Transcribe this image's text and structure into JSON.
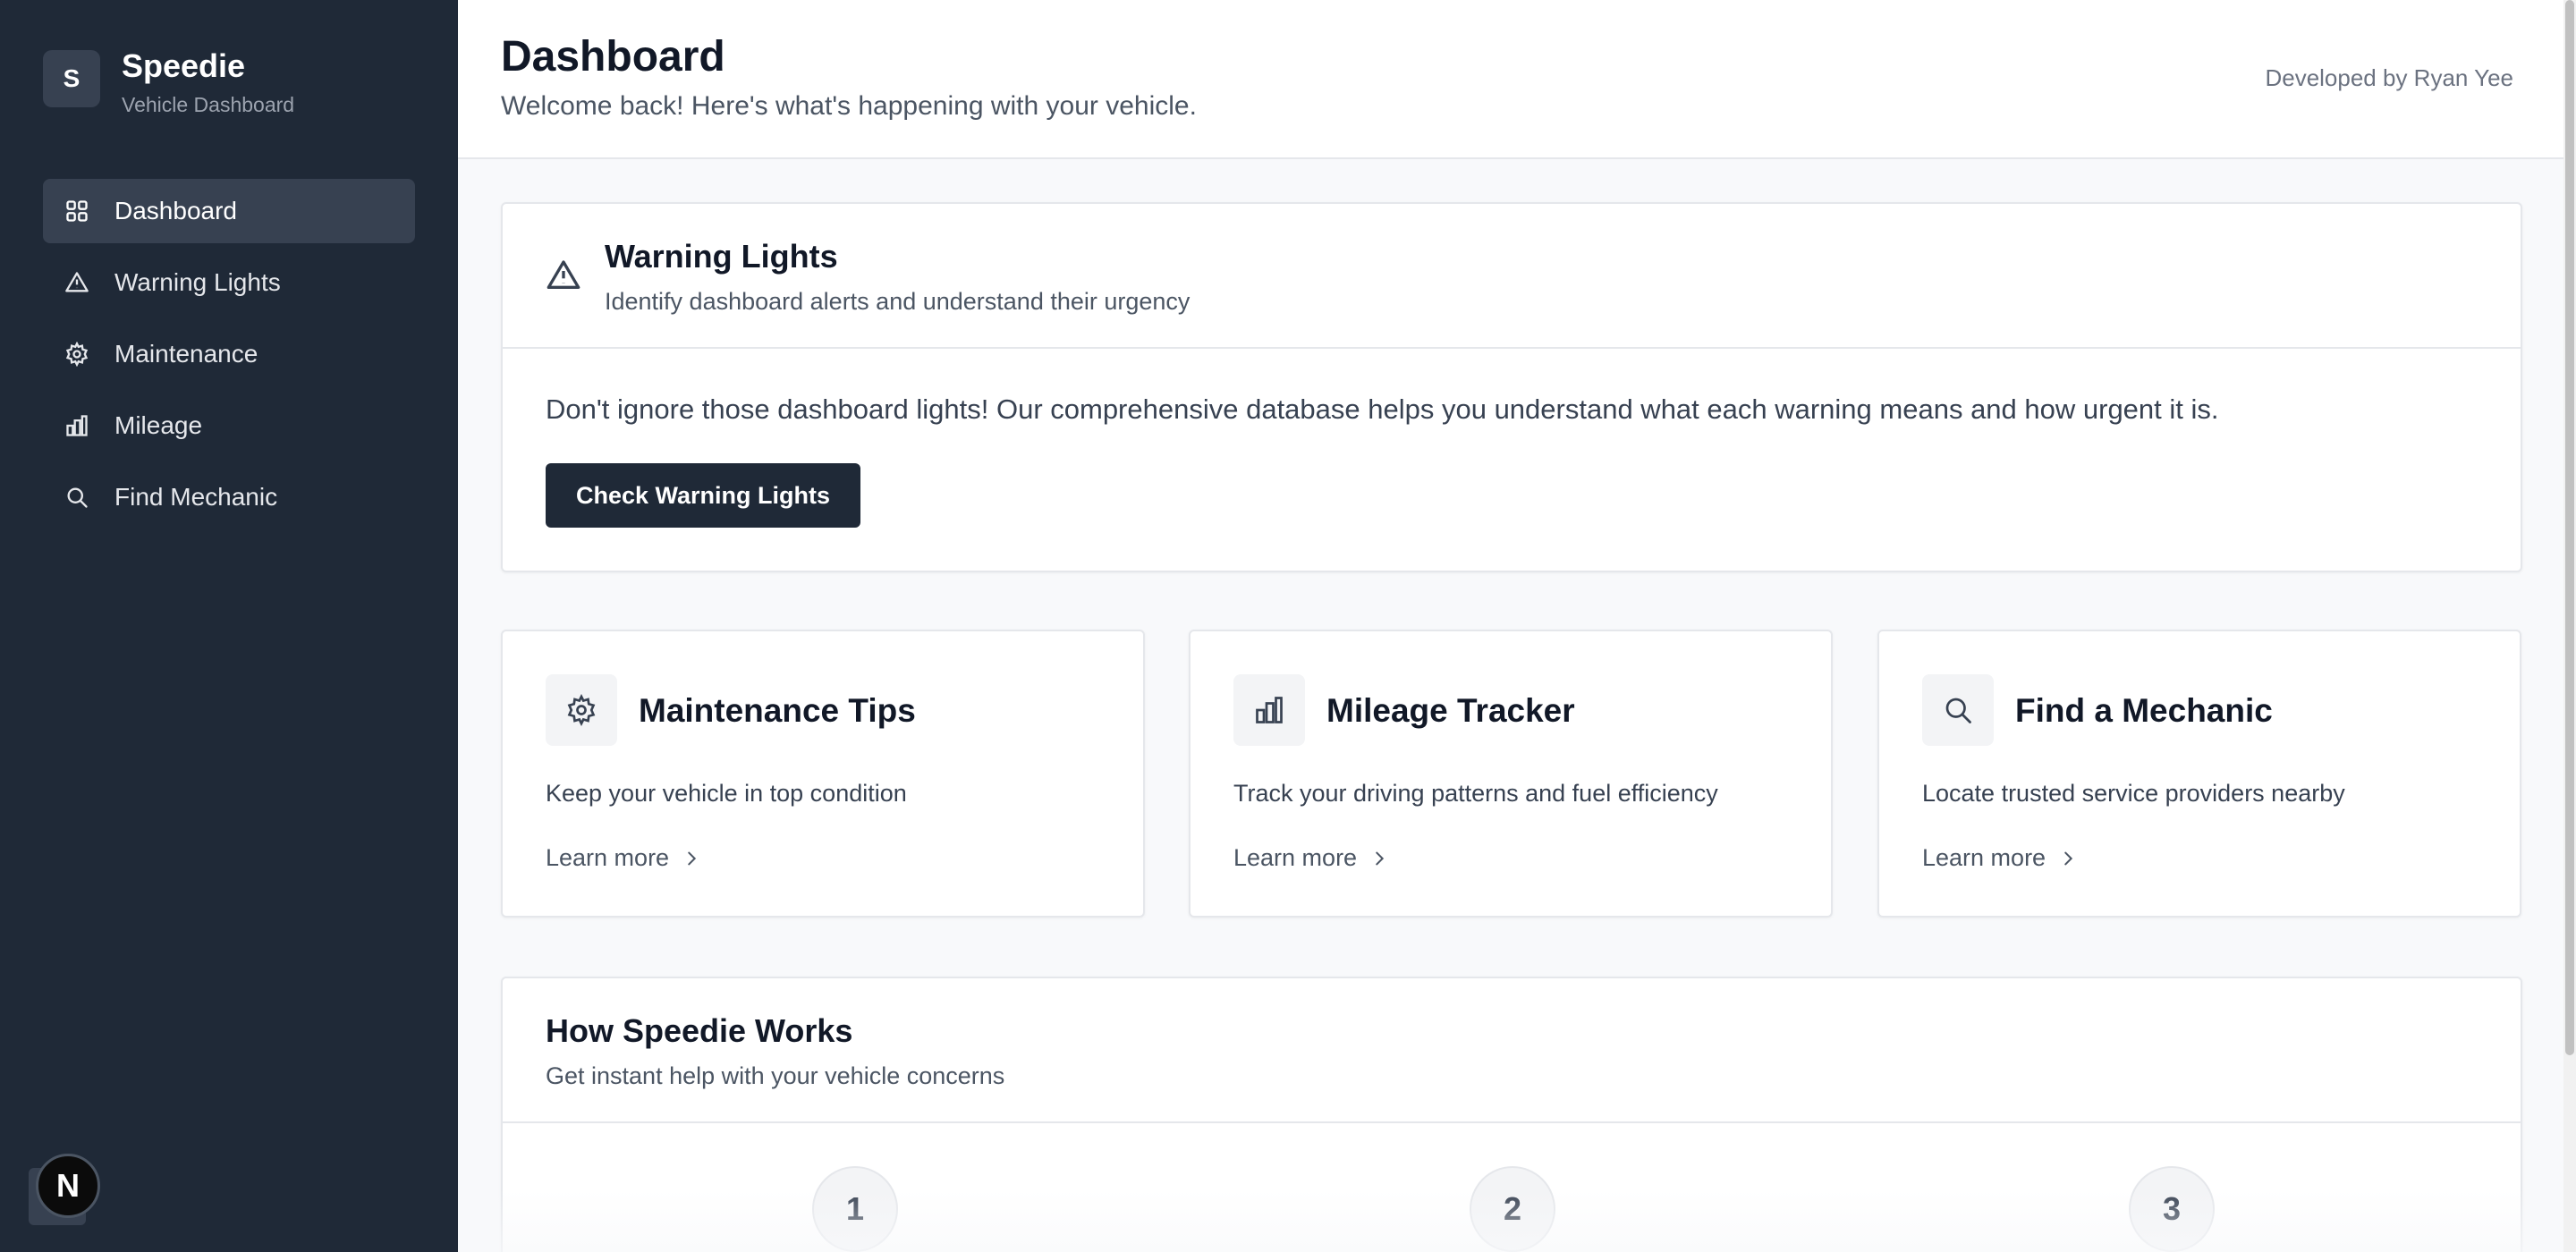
{
  "sidebar": {
    "logo_letter": "S",
    "app_name": "Speedie",
    "app_subtitle": "Vehicle Dashboard",
    "items": [
      {
        "label": "Dashboard",
        "icon": "grid-icon",
        "active": true
      },
      {
        "label": "Warning Lights",
        "icon": "warning-triangle-icon",
        "active": false
      },
      {
        "label": "Maintenance",
        "icon": "gear-icon",
        "active": false
      },
      {
        "label": "Mileage",
        "icon": "bar-chart-icon",
        "active": false
      },
      {
        "label": "Find Mechanic",
        "icon": "search-icon",
        "active": false
      }
    ],
    "dev_badge": "N"
  },
  "header": {
    "title": "Dashboard",
    "subtitle": "Welcome back! Here's what's happening with your vehicle.",
    "credit": "Developed by Ryan Yee"
  },
  "warning_card": {
    "title": "Warning Lights",
    "subtitle": "Identify dashboard alerts and understand their urgency",
    "body": "Don't ignore those dashboard lights! Our comprehensive database helps you understand what each warning means and how urgent it is.",
    "button": "Check Warning Lights",
    "icon": "warning-triangle-icon"
  },
  "features": [
    {
      "title": "Maintenance Tips",
      "description": "Keep your vehicle in top condition",
      "link": "Learn more",
      "icon": "gear-icon"
    },
    {
      "title": "Mileage Tracker",
      "description": "Track your driving patterns and fuel efficiency",
      "link": "Learn more",
      "icon": "bar-chart-icon"
    },
    {
      "title": "Find a Mechanic",
      "description": "Locate trusted service providers nearby",
      "link": "Learn more",
      "icon": "search-icon"
    }
  ],
  "how_it_works": {
    "title": "How Speedie Works",
    "subtitle": "Get instant help with your vehicle concerns",
    "steps": [
      "1",
      "2",
      "3"
    ]
  },
  "colors": {
    "sidebar_bg": "#1f2937",
    "sidebar_active": "#374151",
    "primary_button": "#1f2937",
    "page_bg": "#f8f9fb"
  }
}
